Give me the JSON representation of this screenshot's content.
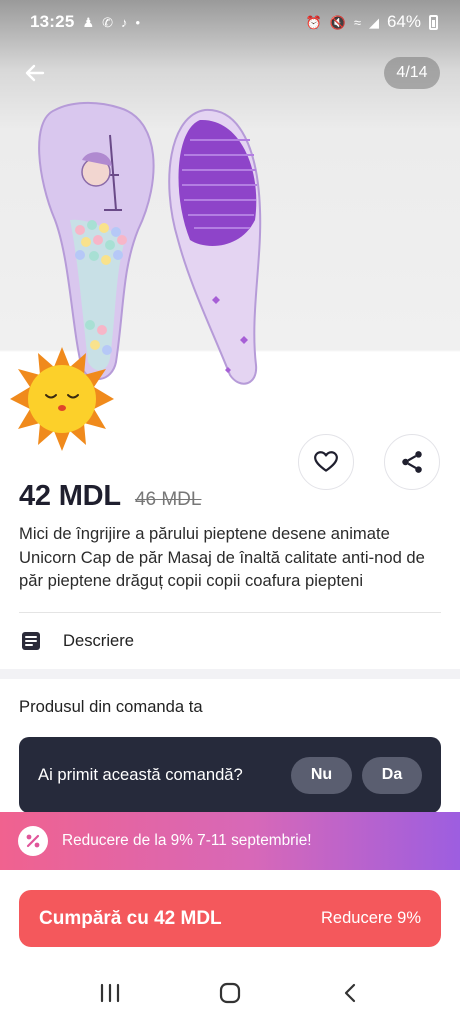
{
  "status_bar": {
    "time": "13:25",
    "battery": "64%",
    "left_icons": [
      "person-icon",
      "whatsapp-icon",
      "tiktok-icon",
      "dot-icon"
    ],
    "right_icons": [
      "alarm-icon",
      "mute-icon",
      "wifi-icon",
      "signal-icon",
      "battery-icon"
    ]
  },
  "gallery": {
    "counter": "4/14"
  },
  "product": {
    "price": "42 MDL",
    "old_price": "46 MDL",
    "title": "Mici de îngrijire a părului pieptene desene animate Unicorn Cap de păr Masaj de înaltă calitate anti-nod de păr pieptene drăguț copii copii coafura piepteni"
  },
  "description": {
    "label": "Descriere"
  },
  "order_section": {
    "heading": "Produsul din comanda ta",
    "question": "Ai primit această comandă?",
    "no_label": "Nu",
    "yes_label": "Da"
  },
  "promo": {
    "text": "Reducere de la 9% 7-11 septembrie!"
  },
  "buy": {
    "label": "Cumpără cu 42 MDL",
    "discount": "Reducere 9%"
  },
  "colors": {
    "buy_button": "#f4585c",
    "order_card": "#262a3b",
    "promo_start": "#f0628f",
    "promo_end": "#9d5ee0"
  }
}
